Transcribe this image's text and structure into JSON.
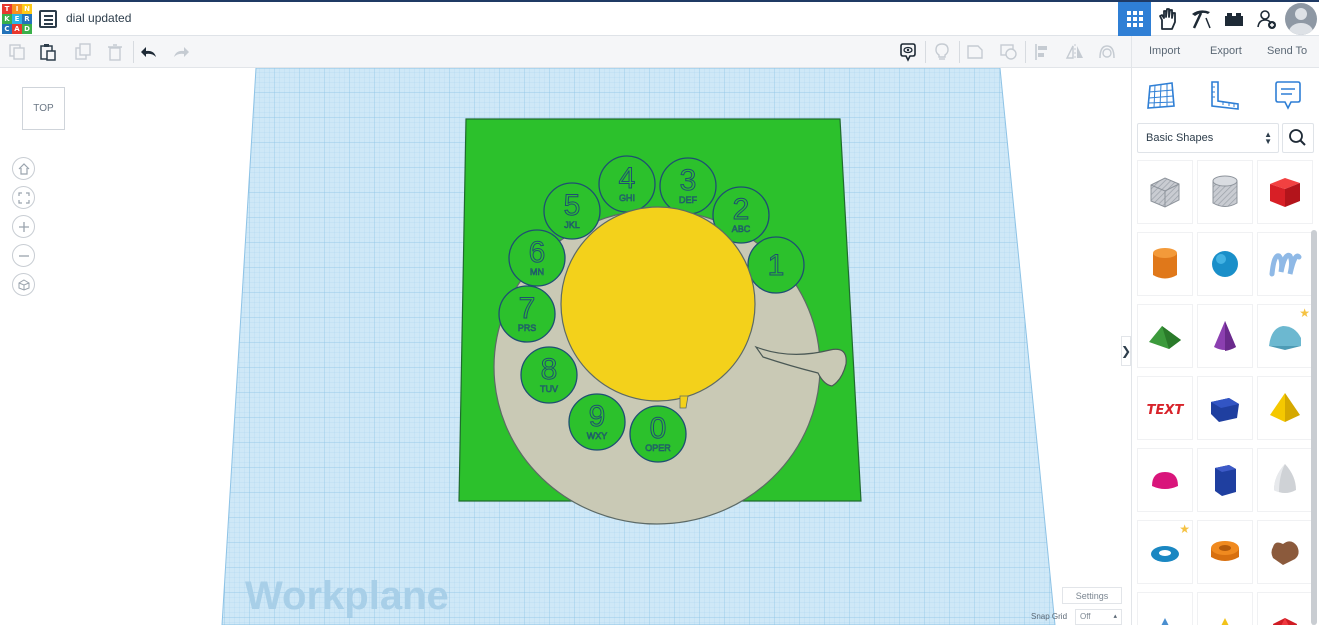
{
  "app": {
    "logo_letters": [
      "T",
      "I",
      "N",
      "K",
      "E",
      "R",
      "C",
      "A",
      "D"
    ],
    "logo_colors": [
      "#e8382d",
      "#f7921e",
      "#fcca17",
      "#3ab04a",
      "#2bb3e6",
      "#2272b9",
      "#2272b9",
      "#e8382d",
      "#3ab04a"
    ],
    "document_title": "dial updated",
    "accent_color": "#2f7fd5"
  },
  "header_buttons": [
    {
      "name": "3d-design-view-icon",
      "active": true
    },
    {
      "name": "blocks-hand-icon",
      "active": false
    },
    {
      "name": "pickaxe-icon",
      "active": false
    },
    {
      "name": "brick-icon",
      "active": false
    },
    {
      "name": "add-user-icon",
      "active": false
    }
  ],
  "toolbar": {
    "tools": [
      "copy-icon",
      "paste-icon",
      "duplicate-icon",
      "delete-icon",
      "undo-icon",
      "redo-icon"
    ],
    "right_tools": [
      "notes-icon",
      "light-bulb-icon",
      "shape-outline-icon",
      "hole-icon",
      "align-icon",
      "mirror-icon",
      "group-icon"
    ],
    "import_label": "Import",
    "export_label": "Export",
    "send_to_label": "Send To"
  },
  "viewport": {
    "view_cube_label": "TOP",
    "nav_buttons": [
      "home-icon",
      "fit-view-icon",
      "zoom-in-icon",
      "zoom-out-icon",
      "orthographic-icon"
    ],
    "workplane_label": "Workplane",
    "settings_label": "Settings",
    "snap_grid_label": "Snap Grid",
    "snap_grid_value": "Off",
    "colors": {
      "base_plate": "#2cc12c",
      "dial_ring": "#c9c9b5",
      "center_disc": "#f3d11b",
      "finger_hole": "#2cc12c"
    },
    "dial_digits": [
      {
        "digit": "1",
        "letters": ""
      },
      {
        "digit": "2",
        "letters": "ABC"
      },
      {
        "digit": "3",
        "letters": "DEF"
      },
      {
        "digit": "4",
        "letters": "GHI"
      },
      {
        "digit": "5",
        "letters": "JKL"
      },
      {
        "digit": "6",
        "letters": "MN"
      },
      {
        "digit": "7",
        "letters": "PRS"
      },
      {
        "digit": "8",
        "letters": "TUV"
      },
      {
        "digit": "9",
        "letters": "WXY"
      },
      {
        "digit": "0",
        "letters": "OPER"
      }
    ]
  },
  "panel": {
    "top_icons": [
      "workplane-grid-icon",
      "ruler-icon",
      "notes-panel-icon"
    ],
    "library_selected": "Basic Shapes",
    "shapes": [
      {
        "name": "box-hole-shape",
        "favorite": false
      },
      {
        "name": "cylinder-hole-shape",
        "favorite": false
      },
      {
        "name": "box-shape",
        "favorite": false
      },
      {
        "name": "cylinder-shape",
        "favorite": false
      },
      {
        "name": "sphere-shape",
        "favorite": false
      },
      {
        "name": "scribble-shape",
        "favorite": false
      },
      {
        "name": "roof-shape",
        "favorite": false
      },
      {
        "name": "cone-shape",
        "favorite": false
      },
      {
        "name": "round-roof-shape",
        "favorite": true
      },
      {
        "name": "text-shape",
        "favorite": false
      },
      {
        "name": "polygon-shape",
        "favorite": false
      },
      {
        "name": "pyramid-shape",
        "favorite": false
      },
      {
        "name": "half-sphere-shape",
        "favorite": false
      },
      {
        "name": "prism-shape",
        "favorite": false
      },
      {
        "name": "paraboloid-shape",
        "favorite": false
      },
      {
        "name": "torus-shape",
        "favorite": true
      },
      {
        "name": "tube-shape",
        "favorite": false
      },
      {
        "name": "heart-shape",
        "favorite": false
      },
      {
        "name": "star-shape",
        "favorite": false
      },
      {
        "name": "star-shape-yellow",
        "favorite": false
      },
      {
        "name": "icosahedron-shape",
        "favorite": false
      }
    ]
  }
}
